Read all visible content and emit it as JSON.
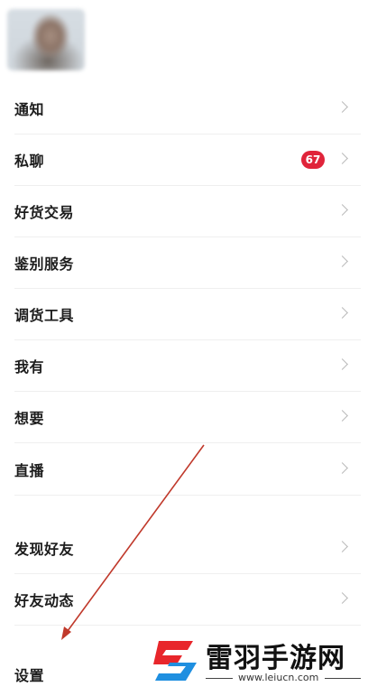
{
  "menu": {
    "items": [
      {
        "label": "通知"
      },
      {
        "label": "私聊",
        "badge": "67"
      },
      {
        "label": "好货交易"
      },
      {
        "label": "鉴别服务"
      },
      {
        "label": "调货工具"
      },
      {
        "label": "我有"
      },
      {
        "label": "想要"
      },
      {
        "label": "直播"
      },
      {
        "label": "发现好友"
      },
      {
        "label": "好友动态"
      },
      {
        "label": "设置"
      }
    ]
  },
  "watermark": {
    "title": "雷羽手游网",
    "url": "www.leiucn.com"
  },
  "colors": {
    "badge": "#e0243a",
    "arrow": "#c0392b",
    "watermark_red": "#e8262b",
    "watermark_blue": "#1f8fe0"
  },
  "icons": [
    "chevron-right-icon",
    "watermark-logo-icon"
  ]
}
